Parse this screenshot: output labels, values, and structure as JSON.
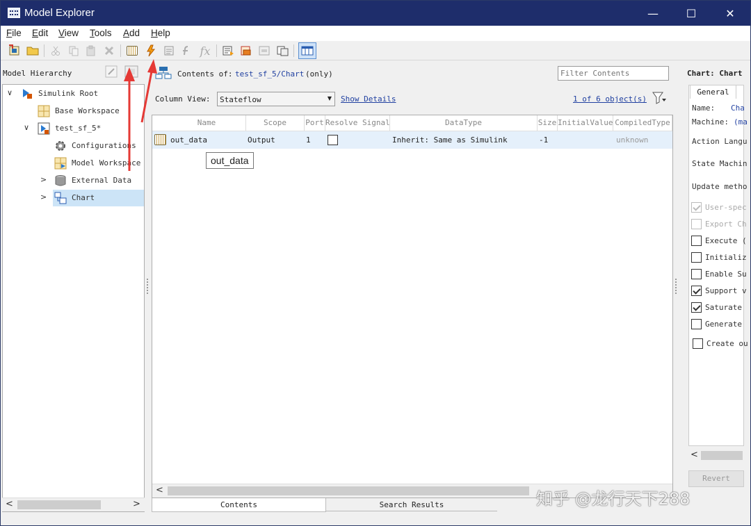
{
  "window": {
    "title": "Model Explorer",
    "minimize": "—",
    "maximize": "☐",
    "close": "✕"
  },
  "menu": [
    {
      "label": "File",
      "key": "F",
      "rest": "ile"
    },
    {
      "label": "Edit",
      "key": "E",
      "rest": "dit"
    },
    {
      "label": "View",
      "key": "V",
      "rest": "iew"
    },
    {
      "label": "Tools",
      "key": "T",
      "rest": "ools"
    },
    {
      "label": "Add",
      "key": "A",
      "rest": "dd"
    },
    {
      "label": "Help",
      "key": "H",
      "rest": "elp"
    }
  ],
  "toolbar": {
    "icons": [
      "new-model-icon",
      "open-folder-icon",
      "cut-icon",
      "copy-icon",
      "paste-icon",
      "delete-icon",
      "add-data-icon",
      "add-event-icon",
      "add-message-icon",
      "add-function-icon",
      "fx-icon",
      "properties-icon",
      "highlight-icon",
      "show-dialog-icon",
      "copy-view-icon",
      "column-layout-icon"
    ],
    "fx_label": "fx"
  },
  "hierarchy": {
    "title": "Model Hierarchy",
    "items": [
      {
        "label": "Simulink Root",
        "expand": "∨"
      },
      {
        "label": "Base Workspace"
      },
      {
        "label": "test_sf_5*",
        "expand": "∨"
      },
      {
        "label": "Configurations"
      },
      {
        "label": "Model Workspace"
      },
      {
        "label": "External Data",
        "expand": ">"
      },
      {
        "label": "Chart",
        "expand": ">"
      }
    ]
  },
  "contents": {
    "prefix": "Contents of:",
    "path": "test_sf_5/Chart",
    "suffix": "(only)",
    "filter_placeholder": "Filter Contents",
    "column_view_label": "Column View:",
    "column_view_value": "Stateflow",
    "show_details": "Show Details",
    "object_count": "1 of 6 object(s)",
    "columns": [
      "Name",
      "Scope",
      "Port",
      "Resolve Signal",
      "DataType",
      "Size",
      "InitialValue",
      "CompiledType"
    ],
    "rows": [
      {
        "name": "out_data",
        "scope": "Output",
        "port": "1",
        "datatype": "Inherit: Same as Simulink",
        "size": "-1",
        "initial": "",
        "compiled": "unknown"
      }
    ],
    "tooltip": "out_data",
    "tabs": [
      "Contents",
      "Search Results"
    ]
  },
  "properties": {
    "title": "Chart: Chart",
    "tab": "General",
    "name_label": "Name:",
    "name_value": "Cha",
    "machine_label": "Machine:",
    "machine_value": "(ma",
    "fields": [
      "Action Langu",
      "State Machin",
      "Update metho"
    ],
    "checkboxes": [
      {
        "label": "User-spec",
        "checked": true,
        "disabled": true
      },
      {
        "label": "Export Ch",
        "checked": false,
        "disabled": true
      },
      {
        "label": "Execute (",
        "checked": false,
        "disabled": false
      },
      {
        "label": "Initializ",
        "checked": false,
        "disabled": false
      },
      {
        "label": "Enable Su",
        "checked": false,
        "disabled": false
      },
      {
        "label": "Support v",
        "checked": true,
        "disabled": false
      },
      {
        "label": "Saturate",
        "checked": true,
        "disabled": false
      },
      {
        "label": "Generate",
        "checked": false,
        "disabled": false
      },
      {
        "label": "Create ou",
        "checked": false,
        "disabled": false
      }
    ],
    "revert": "Revert"
  },
  "watermark": "知乎 @龙行天下288",
  "colors": {
    "titlebar": "#1e2d6b",
    "selection": "#cce4f7",
    "annotation": "#e53935"
  }
}
